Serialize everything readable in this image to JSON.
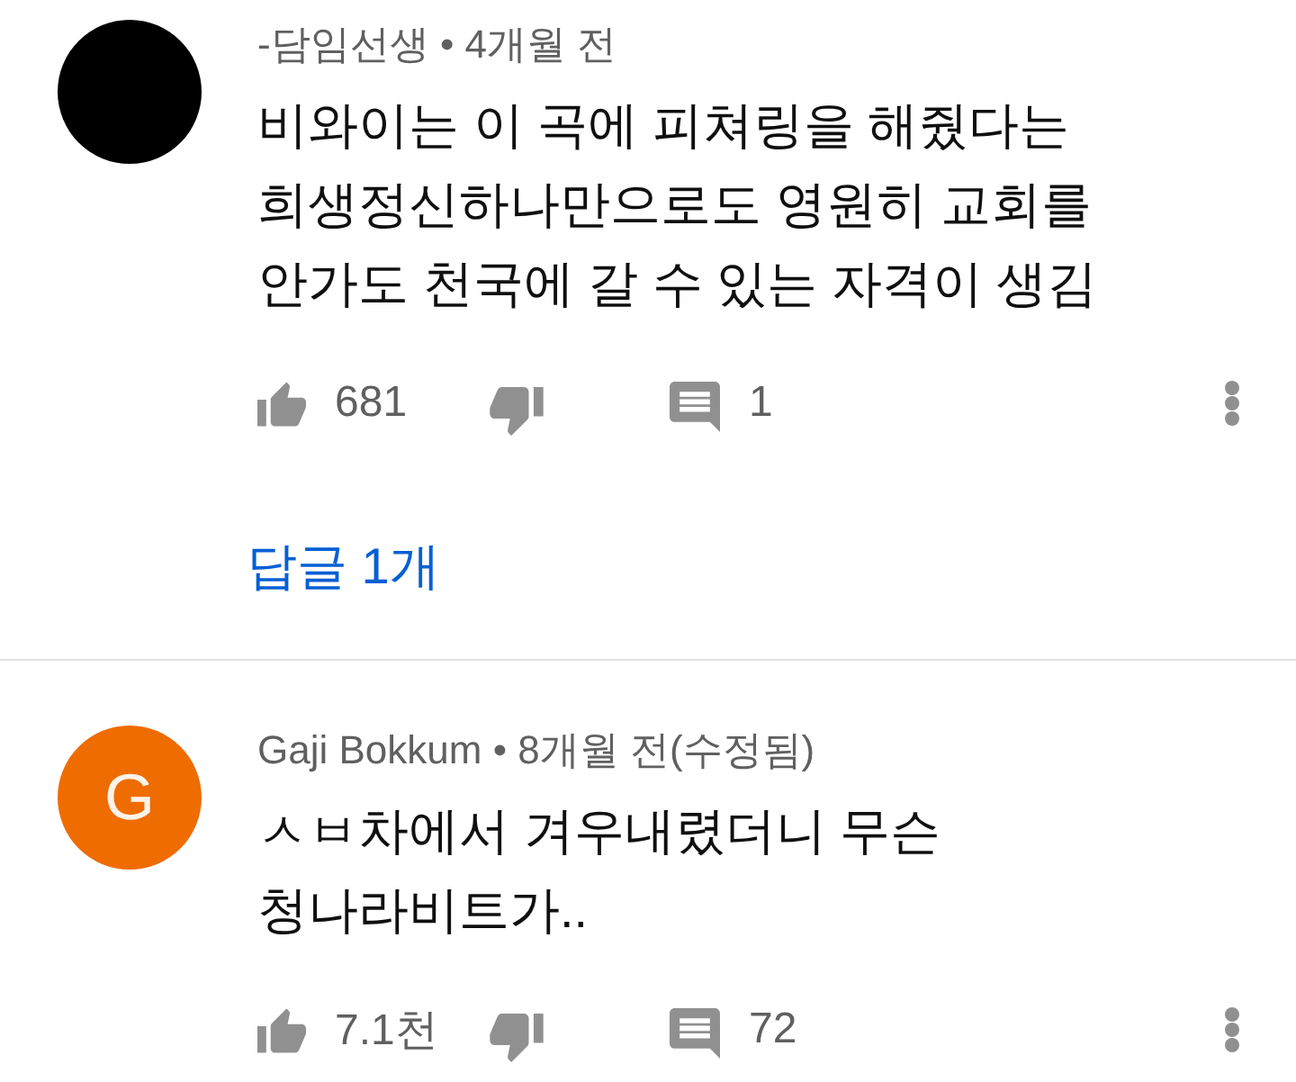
{
  "comments": [
    {
      "avatar": {
        "kind": "plain",
        "color": "#000000"
      },
      "meta": "-담임선생 • 4개월 전",
      "text": "비와이는 이 곡에 피쳐링을 해줬다는\n희생정신하나만으로도 영원히 교회를\n안가도 천국에 갈 수 있는 자격이 생김",
      "likes": "681",
      "replies": "1",
      "replies_link": "답글 1개"
    },
    {
      "avatar": {
        "kind": "letter",
        "letter": "G",
        "color": "#ef6c00"
      },
      "meta": "Gaji Bokkum • 8개월 전(수정됨)",
      "text": "ㅅㅂ차에서 겨우내렸더니 무슨\n청나라비트가..",
      "likes": "7.1천",
      "replies": "72"
    }
  ]
}
